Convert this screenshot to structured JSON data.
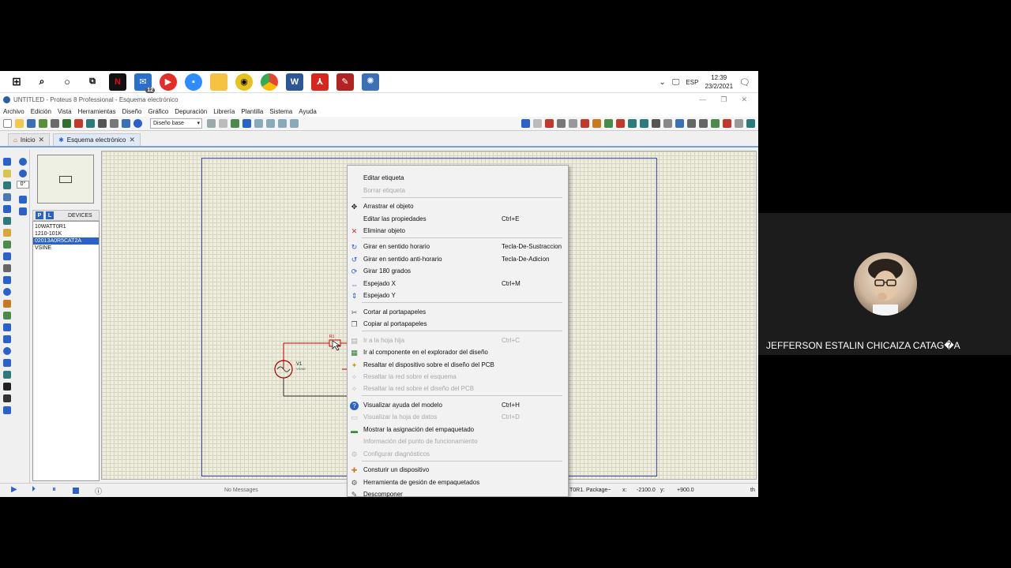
{
  "taskbar": {
    "notif_count": "12",
    "lang": "ESP",
    "time": "12:39",
    "date": "23/2/2021",
    "action_center_count": "1"
  },
  "window": {
    "title": "UNTITLED - Proteus 8 Professional - Esquema electrónico"
  },
  "menubar": [
    "Archivo",
    "Edición",
    "Vista",
    "Herramientas",
    "Diseño",
    "Gráfico",
    "Depuración",
    "Librería",
    "Plantilla",
    "Sistema",
    "Ayuda"
  ],
  "toolbar": {
    "design_select": "Diseño base"
  },
  "tabs": [
    {
      "label": "Inicio"
    },
    {
      "label": "Esquema electrónico"
    }
  ],
  "left_panel": {
    "rotation": "0°",
    "p_btn": "P",
    "l_btn": "L",
    "devices_title": "DEVICES",
    "devices": [
      "10WATT0R1",
      "1210-101K",
      "02013A0R5CAT2A",
      "VSINE"
    ],
    "selected_device_index": 2
  },
  "schematic": {
    "source_ref": "V1",
    "source_value": "VSINE",
    "resistor_ref": "R1"
  },
  "statusbar": {
    "messages": "No Messages",
    "package_text": "T0R1. Package~",
    "coord_x_label": "x:",
    "coord_x": "-2100.0",
    "coord_y_label": "y:",
    "coord_y": "+900.0",
    "unit": "th"
  },
  "context_menu": {
    "items": [
      {
        "label": "Editar etiqueta",
        "shortcut": "",
        "icon": "none",
        "disabled": false
      },
      {
        "label": "Borrar etiqueta",
        "shortcut": "",
        "icon": "none",
        "disabled": true
      },
      {
        "label": "Arrastrar el objeto",
        "shortcut": "",
        "icon": "move-icon",
        "disabled": false
      },
      {
        "label": "Editar las propiedades",
        "shortcut": "Ctrl+E",
        "icon": "none",
        "disabled": false
      },
      {
        "label": "Eliminar objeto",
        "shortcut": "",
        "icon": "delete-x-icon",
        "disabled": false
      },
      {
        "label": "Girar en sentido horario",
        "shortcut": "Tecla-De-Sustraccion",
        "icon": "rotate-cw-icon",
        "disabled": false
      },
      {
        "label": "Girar en sentido anti-horario",
        "shortcut": "Tecla-De-Adicion",
        "icon": "rotate-ccw-icon",
        "disabled": false
      },
      {
        "label": "Girar 180 grados",
        "shortcut": "",
        "icon": "rotate-180-icon",
        "disabled": false
      },
      {
        "label": "Espejado X",
        "shortcut": "Ctrl+M",
        "icon": "mirror-x-icon",
        "disabled": false
      },
      {
        "label": "Espejado Y",
        "shortcut": "",
        "icon": "mirror-y-icon",
        "disabled": false
      },
      {
        "label": "Cortar al portapapeles",
        "shortcut": "",
        "icon": "cut-icon",
        "disabled": false
      },
      {
        "label": "Copiar al portapapeles",
        "shortcut": "",
        "icon": "copy-icon",
        "disabled": false
      },
      {
        "label": "Ir a la hoja hija",
        "shortcut": "Ctrl+C",
        "icon": "child-sheet-icon",
        "disabled": true
      },
      {
        "label": "Ir al componente en el explorador del diseño",
        "shortcut": "",
        "icon": "explorer-icon",
        "disabled": false
      },
      {
        "label": "Resaltar el dispositivo sobre el diseño del PCB",
        "shortcut": "",
        "icon": "highlight-icon",
        "disabled": false
      },
      {
        "label": "Resaltar la red sobre el esquema",
        "shortcut": "",
        "icon": "net-icon",
        "disabled": true
      },
      {
        "label": "Resaltar la red sobre el diseño del PCB",
        "shortcut": "",
        "icon": "net-pcb-icon",
        "disabled": true
      },
      {
        "label": "Visualizar ayuda del modelo",
        "shortcut": "Ctrl+H",
        "icon": "help-icon",
        "disabled": false
      },
      {
        "label": "Visualizar la hoja de datos",
        "shortcut": "Ctrl+D",
        "icon": "datasheet-icon",
        "disabled": true
      },
      {
        "label": "Mostrar la asignación del empaquetado",
        "shortcut": "",
        "icon": "package-icon",
        "disabled": false
      },
      {
        "label": "Información del punto de funcionamiento",
        "shortcut": "",
        "icon": "none",
        "disabled": true
      },
      {
        "label": "Configurar diagnósticos",
        "shortcut": "",
        "icon": "diagnostics-icon",
        "disabled": true
      },
      {
        "label": "Consturir un dispositivo",
        "shortcut": "",
        "icon": "make-device-icon",
        "disabled": false
      },
      {
        "label": "Herramienta de gesión de  empaquetados",
        "shortcut": "",
        "icon": "packaging-tool-icon",
        "disabled": false
      },
      {
        "label": "Descomponer",
        "shortcut": "",
        "icon": "decompose-icon",
        "disabled": false
      }
    ]
  },
  "participant": {
    "name": "JEFFERSON ESTALIN CHICAIZA CATAG�A"
  }
}
